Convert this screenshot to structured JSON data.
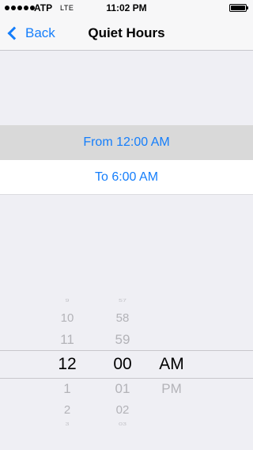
{
  "status_bar": {
    "carrier": "ATP",
    "network": "LTE",
    "time": "11:02 PM"
  },
  "nav": {
    "back_label": "Back",
    "title": "Quiet Hours"
  },
  "rows": {
    "from_label": "From 12:00 AM",
    "to_label": "To 6:00 AM"
  },
  "picker": {
    "hours": [
      "9",
      "10",
      "11",
      "12",
      "1",
      "2",
      "3"
    ],
    "minutes": [
      "57",
      "58",
      "59",
      "00",
      "01",
      "02",
      "03"
    ],
    "period": [
      "AM",
      "PM"
    ]
  },
  "colors": {
    "accent": "#157efb",
    "background": "#efeff4",
    "selected_row": "#d9d9d9"
  }
}
